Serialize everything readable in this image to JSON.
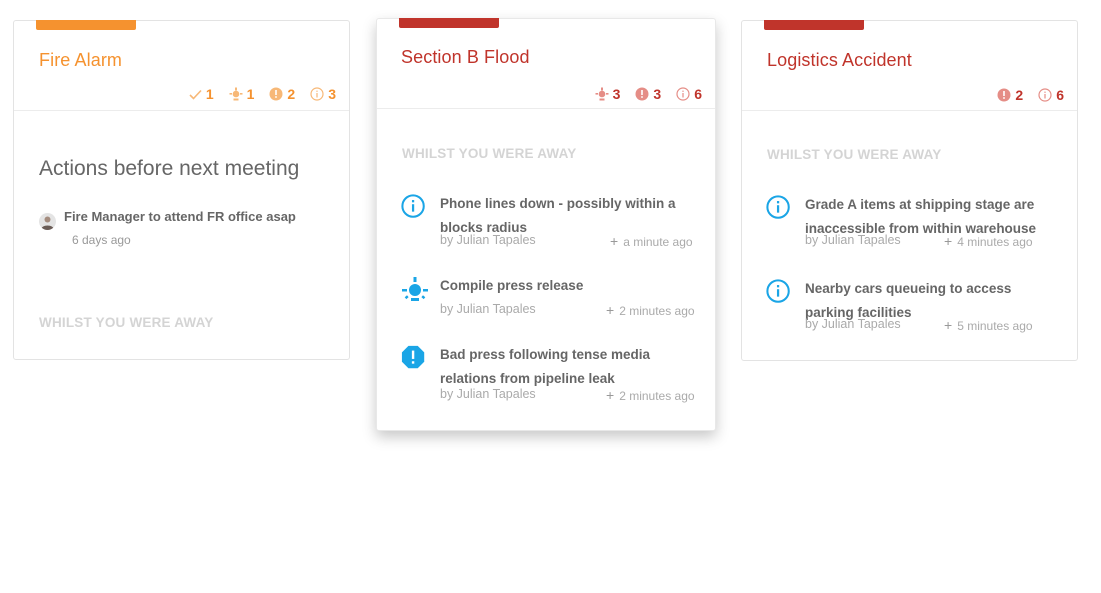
{
  "colors": {
    "orange": "#f5922f",
    "red": "#c0342b",
    "blue": "#1aa5e6",
    "muted_text": "#d4d4d4"
  },
  "cards": [
    {
      "title": "Fire Alarm",
      "accent_color": "#f5922f",
      "counts": {
        "actions": "1",
        "ideas": "1",
        "issues": "2",
        "info": "3"
      },
      "actions_heading": "Actions before next meeting",
      "action": {
        "text": "Fire Manager to attend FR office asap",
        "time": "6 days ago"
      },
      "away_heading": "WHILST YOU WERE AWAY"
    },
    {
      "title": "Section B Flood",
      "accent_color": "#c0342b",
      "counts": {
        "ideas": "3",
        "issues": "3",
        "info": "6"
      },
      "away_heading": "WHILST YOU WERE AWAY",
      "items": [
        {
          "icon": "info-icon",
          "text": "Phone lines down - possibly within a blocks radius",
          "author": "by Julian Tapales",
          "time": "a minute ago"
        },
        {
          "icon": "lightbulb-icon",
          "text": "Compile press release",
          "author": "by Julian Tapales",
          "time": "2 minutes ago"
        },
        {
          "icon": "alert-icon",
          "text": "Bad press following tense media relations from pipeline leak",
          "author": "by Julian Tapales",
          "time": "2 minutes ago"
        }
      ]
    },
    {
      "title": "Logistics Accident",
      "accent_color": "#c0342b",
      "counts": {
        "issues": "2",
        "info": "6"
      },
      "away_heading": "WHILST YOU WERE AWAY",
      "items": [
        {
          "icon": "info-icon",
          "text": "Grade A items at shipping stage are inaccessible from within warehouse",
          "author": "by Julian Tapales",
          "time": "4 minutes ago"
        },
        {
          "icon": "info-icon",
          "text": "Nearby cars queueing to access parking facilities",
          "author": "by Julian Tapales",
          "time": "5 minutes ago"
        }
      ]
    }
  ]
}
